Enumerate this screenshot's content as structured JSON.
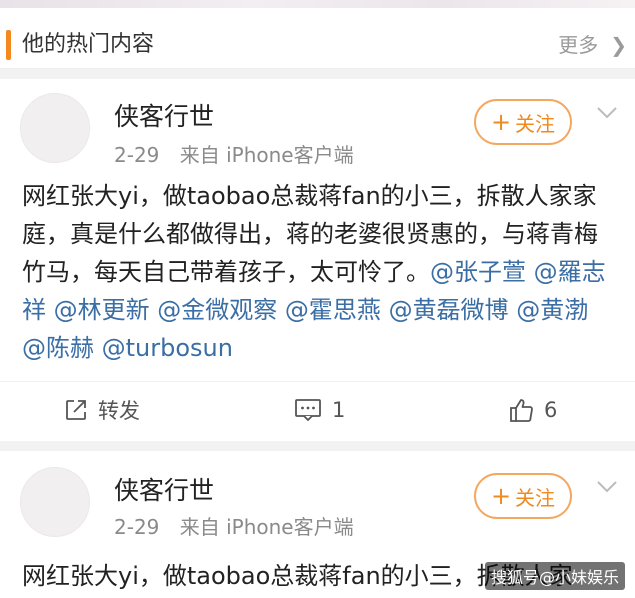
{
  "section": {
    "title": "他的热门内容",
    "more_label": "更多"
  },
  "posts": [
    {
      "username": "侠客行世",
      "date": "2-29",
      "source": "来自 iPhone客户端",
      "follow_label": "关注",
      "text": "网红张大yi，做taobao总裁蒋fan的小三，拆散人家家庭，真是什么都做得出，蒋的老婆很贤惠的，与蒋青梅竹马，每天自己带着孩子，太可怜了。",
      "mentions": [
        "@张子萱",
        "@羅志祥",
        "@林更新",
        "@金微观察",
        "@霍思燕",
        "@黄磊微博",
        "@黄渤",
        "@陈赫",
        "@turbosun"
      ],
      "repost_label": "转发",
      "comment_count": "1",
      "like_count": "6"
    },
    {
      "username": "侠客行世",
      "date": "2-29",
      "source": "来自 iPhone客户端",
      "follow_label": "关注",
      "text_partial": "网红张大yi，做taobao总裁蒋fan的小三，拆散人家"
    }
  ],
  "watermark": "搜狐号@小妹娱乐",
  "colors": {
    "accent": "#f48a1f",
    "mention": "#3a6ea5",
    "muted": "#8a8a8a"
  }
}
